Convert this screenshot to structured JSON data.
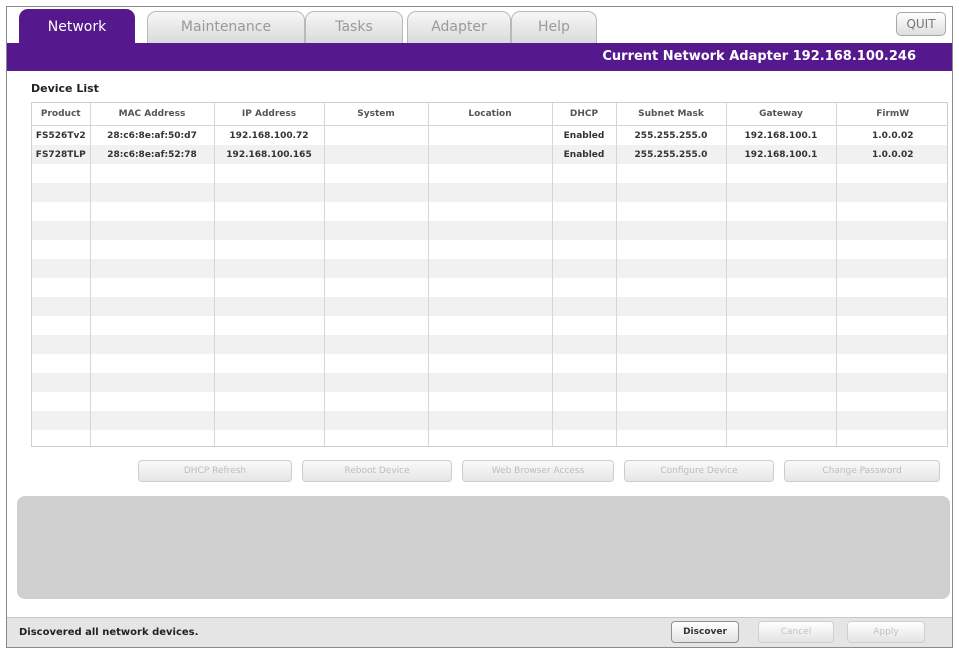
{
  "tabs": [
    {
      "label": "Network",
      "active": true
    },
    {
      "label": "Maintenance",
      "active": false
    },
    {
      "label": "Tasks",
      "active": false
    },
    {
      "label": "Adapter",
      "active": false
    },
    {
      "label": "Help",
      "active": false
    }
  ],
  "quit_label": "QUIT",
  "adapter_text": "Current Network Adapter 192.168.100.246",
  "device_list": {
    "title": "Device List",
    "columns": [
      "Product",
      "MAC Address",
      "IP Address",
      "System",
      "Location",
      "DHCP",
      "Subnet Mask",
      "Gateway",
      "FirmW"
    ],
    "rows": [
      [
        "FS526Tv2",
        "28:c6:8e:af:50:d7",
        "192.168.100.72",
        "",
        "",
        "Enabled",
        "255.255.255.0",
        "192.168.100.1",
        "1.0.0.02"
      ],
      [
        "FS728TLP",
        "28:c6:8e:af:52:78",
        "192.168.100.165",
        "",
        "",
        "Enabled",
        "255.255.255.0",
        "192.168.100.1",
        "1.0.0.02"
      ]
    ]
  },
  "actions": {
    "dhcp_refresh": "DHCP Refresh",
    "reboot_device": "Reboot Device",
    "web_browser_access": "Web Browser Access",
    "configure_device": "Configure Device",
    "change_password": "Change Password"
  },
  "status": {
    "message": "Discovered all network devices.",
    "discover": "Discover",
    "cancel": "Cancel",
    "apply": "Apply"
  },
  "colors": {
    "accent": "#55198d"
  }
}
